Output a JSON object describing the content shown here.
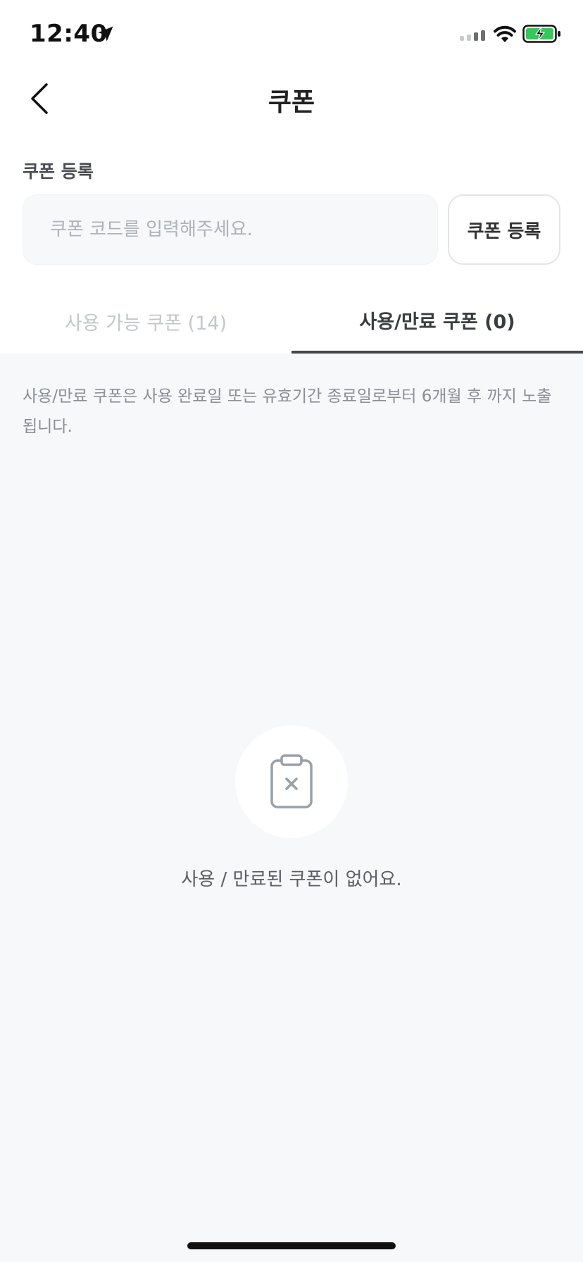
{
  "status_bar": {
    "time": "12:40",
    "icons": [
      "location-arrow-icon",
      "cellular-signal-icon",
      "wifi-icon",
      "battery-charging-icon"
    ],
    "battery_color": "#34c759"
  },
  "nav": {
    "back_icon": "chevron-left-icon",
    "title": "쿠폰"
  },
  "register": {
    "label": "쿠폰 등록",
    "input_value": "",
    "input_placeholder": "쿠폰 코드를 입력해주세요.",
    "button_label": "쿠폰 등록"
  },
  "tabs": [
    {
      "label": "사용 가능 쿠폰 (14)",
      "selected": false
    },
    {
      "label": "사용/만료 쿠폰 (0)",
      "selected": true
    }
  ],
  "content": {
    "notice": "사용/만료 쿠폰은 사용 완료일 또는 유효기간 종료일로부터 6개월 후 까지 노출됩니다.",
    "empty_icon": "clipboard-x-icon",
    "empty_message": "사용 / 만료된 쿠폰이 없어요."
  },
  "colors": {
    "content_background": "#f6f8fa",
    "active_tab_underline": "#44474c",
    "inactive_tab_text": "#c3c7cc"
  }
}
